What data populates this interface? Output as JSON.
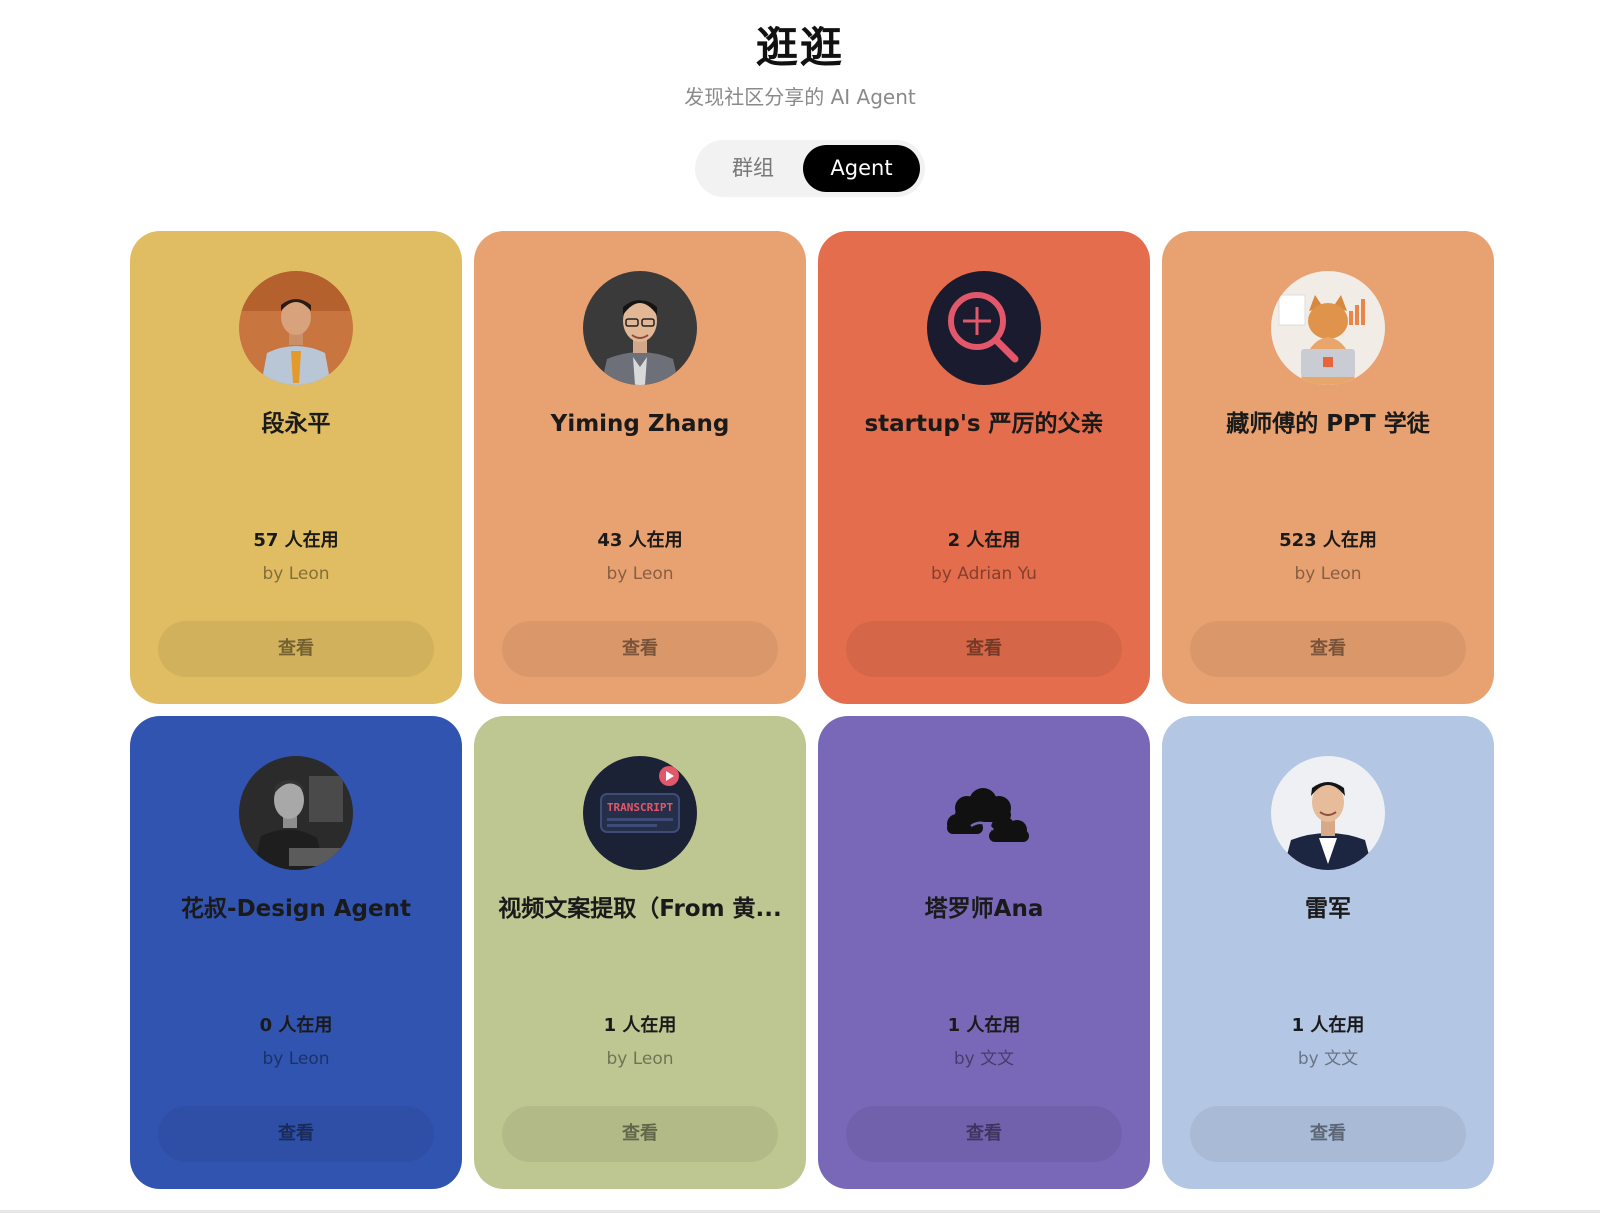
{
  "header": {
    "title": "逛逛",
    "subtitle": "发现社区分享的 AI Agent"
  },
  "toggle": {
    "tabs": [
      {
        "label": "群组",
        "active": false
      },
      {
        "label": "Agent",
        "active": true
      }
    ]
  },
  "cards": [
    {
      "name": "段永平",
      "users": "57 人在用",
      "author": "by Leon",
      "button": "查看",
      "color": "#E0BD62",
      "avatar": "photo-man-orange-tie"
    },
    {
      "name": "Yiming Zhang",
      "users": "43 人在用",
      "author": "by Leon",
      "button": "查看",
      "color": "#E8A271",
      "avatar": "photo-man-glasses"
    },
    {
      "name": "startup's 严厉的父亲",
      "users": "2 人在用",
      "author": "by Adrian Yu",
      "button": "查看",
      "color": "#E36D4C",
      "avatar": "magnifier-icon"
    },
    {
      "name": "藏师傅的 PPT 学徒",
      "users": "523 人在用",
      "author": "by Leon",
      "button": "查看",
      "color": "#E8A271",
      "avatar": "cat-laptop-image"
    },
    {
      "name": "花叔-Design Agent",
      "users": "0 人在用",
      "author": "by Leon",
      "button": "查看",
      "color": "#3154B0",
      "avatar": "photo-man-laptop-bw"
    },
    {
      "name": "视频文案提取（From 黄...",
      "users": "1 人在用",
      "author": "by Leon",
      "button": "查看",
      "color": "#BEC791",
      "avatar": "transcript-icon"
    },
    {
      "name": "塔罗师Ana",
      "users": "1 人在用",
      "author": "by 文文",
      "button": "查看",
      "color": "#7968B8",
      "avatar": "cloud-icon"
    },
    {
      "name": "雷军",
      "users": "1 人在用",
      "author": "by 文文",
      "button": "查看",
      "color": "#B3C6E3",
      "avatar": "photo-man-suit"
    }
  ]
}
